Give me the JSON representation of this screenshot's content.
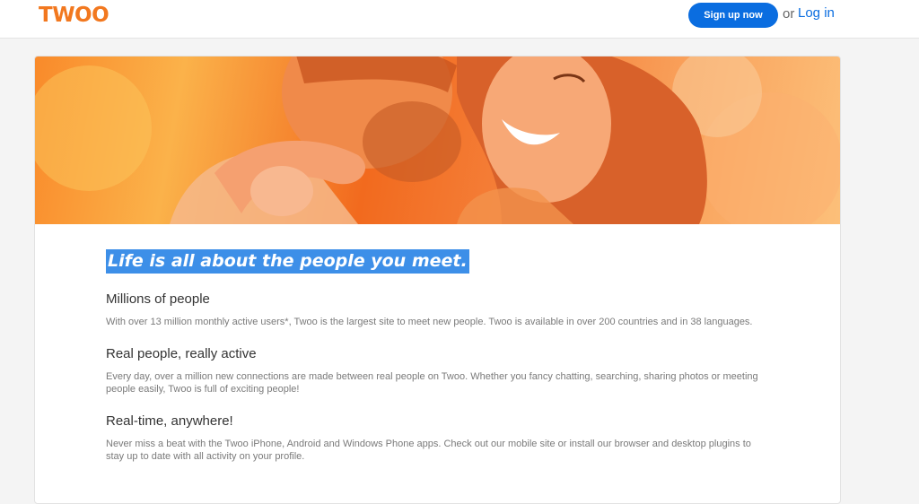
{
  "header": {
    "logo": "TWOO",
    "signup_label": "Sign up now",
    "or_text": "or",
    "login_label": "Log in"
  },
  "colors": {
    "brand_orange": "#f2781f",
    "primary_blue": "#0a6de0",
    "selection_blue": "#3d8fe8"
  },
  "hero": {
    "image": "couple-embracing-photo"
  },
  "main": {
    "headline": "Life is all about the people you meet.",
    "sections": [
      {
        "title": "Millions of people",
        "text": "With over 13 million monthly active users*, Twoo is the largest site to meet new people. Twoo is available in over 200 countries and in 38 languages."
      },
      {
        "title": "Real people, really active",
        "text": "Every day, over a million new connections are made between real people on Twoo. Whether you fancy chatting, searching, sharing photos or meeting people easily, Twoo is full of exciting people!"
      },
      {
        "title": "Real-time, anywhere!",
        "text": "Never miss a beat with the Twoo iPhone, Android and Windows Phone apps. Check out our mobile site or install our browser and desktop plugins to stay up to date with all activity on your profile."
      }
    ]
  }
}
